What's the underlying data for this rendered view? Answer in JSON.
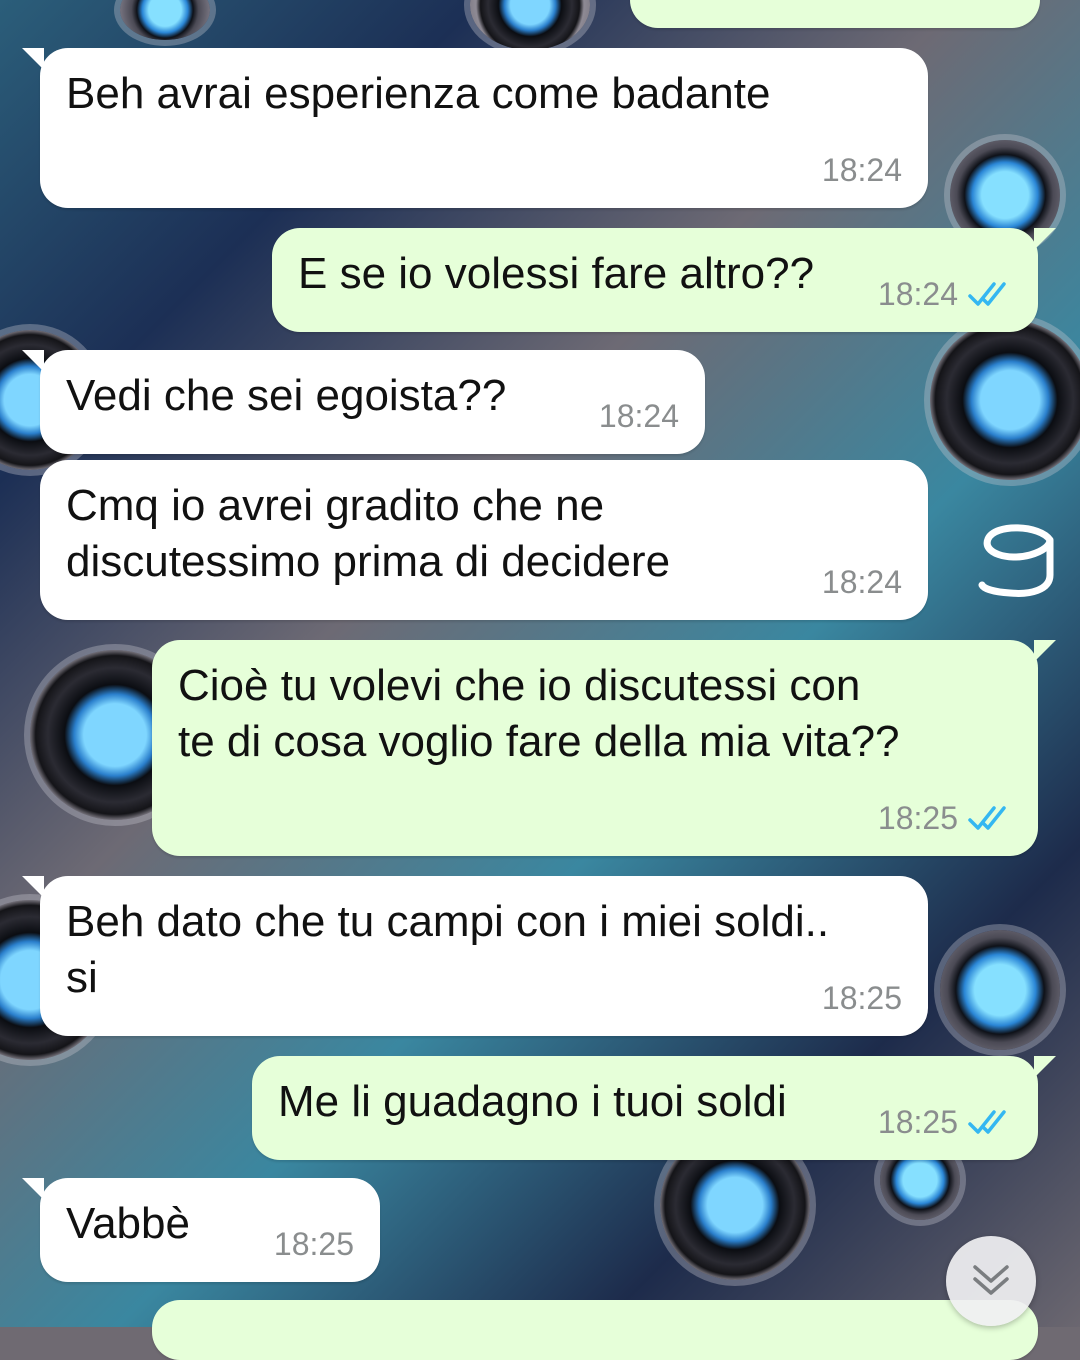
{
  "messages": [
    {
      "id": "m1",
      "direction": "in",
      "text": "Beh avrai esperienza come badante",
      "time": "18:24"
    },
    {
      "id": "m2",
      "direction": "out",
      "text": "E se io volessi fare altro??",
      "time": "18:24",
      "status": "read"
    },
    {
      "id": "m3",
      "direction": "in",
      "text": "Vedi che sei egoista??",
      "time": "18:24"
    },
    {
      "id": "m4",
      "direction": "in",
      "text": "Cmq io avrei gradito che ne\ndiscutessimo prima di decidere",
      "time": "18:24"
    },
    {
      "id": "m5",
      "direction": "out",
      "text": "Cioè tu volevi che io discutessi con\nte di cosa voglio fare della mia vita??",
      "time": "18:25",
      "status": "read"
    },
    {
      "id": "m6",
      "direction": "in",
      "text": "Beh dato che tu campi con i miei soldi..\nsi",
      "time": "18:25"
    },
    {
      "id": "m7",
      "direction": "out",
      "text": "Me li guadagno i tuoi soldi",
      "time": "18:25",
      "status": "read"
    },
    {
      "id": "m8",
      "direction": "in",
      "text": "Vabbè",
      "time": "18:25"
    }
  ],
  "icons": {
    "read_receipt": "double-check-icon",
    "scroll_down": "chevron-double-down-icon",
    "annotation": "handwritten-mark"
  },
  "colors": {
    "incoming_bubble": "#ffffff",
    "outgoing_bubble": "#e6ffd9",
    "timestamp": "#8a8d8e",
    "read_tick": "#34b7f1"
  }
}
